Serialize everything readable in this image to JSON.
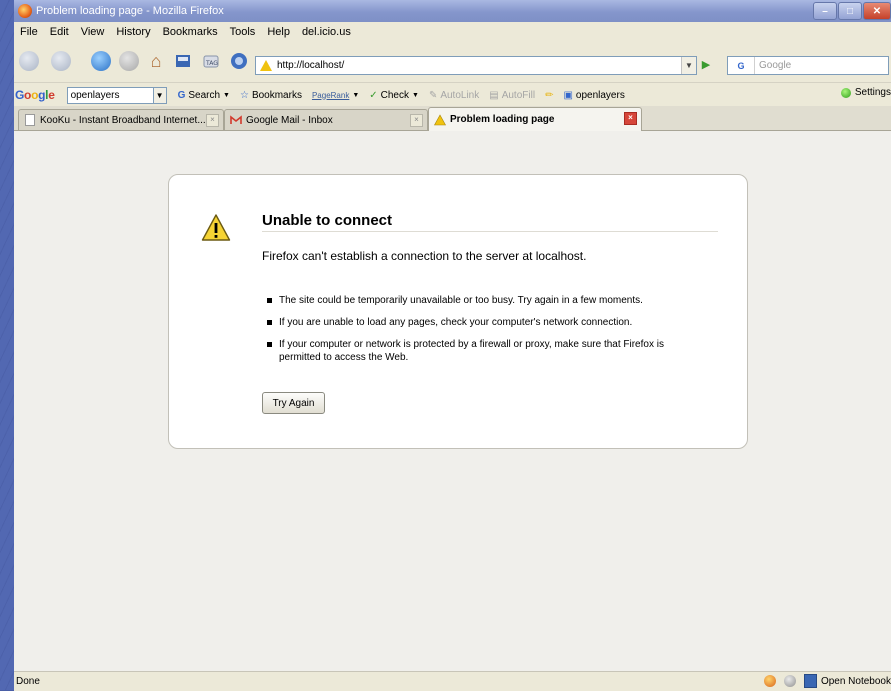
{
  "window": {
    "title": "Problem loading page - Mozilla Firefox",
    "controls": {
      "minimize": "–",
      "maximize": "□",
      "close": "✕"
    }
  },
  "menu": [
    "File",
    "Edit",
    "View",
    "History",
    "Bookmarks",
    "Tools",
    "Help",
    "del.icio.us"
  ],
  "navigation": {
    "url": "http://localhost/",
    "search_placeholder": "Google",
    "search_engine_icon": "G",
    "tag_label": "TAG"
  },
  "google_toolbar": {
    "search_value": "openlayers",
    "search_button": "Search",
    "bookmarks": "Bookmarks",
    "pagerank": "PageRank",
    "check": "Check",
    "autolink": "AutoLink",
    "autofill": "AutoFill",
    "highlight_term": "openlayers",
    "settings": "Settings"
  },
  "tabs": [
    {
      "label": "KooKu - Instant Broadband Internet...",
      "active": false
    },
    {
      "label": "Google Mail - Inbox",
      "active": false
    },
    {
      "label": "Problem loading page",
      "active": true
    }
  ],
  "error": {
    "title": "Unable to connect",
    "description": "Firefox can't establish a connection to the server at localhost.",
    "bullets": [
      "The site could be temporarily unavailable or too busy. Try again in a few moments.",
      "If you are unable to load any pages, check your computer's network connection.",
      "If your computer or network is protected by a firewall or proxy, make sure that Firefox is permitted to access the Web."
    ],
    "button": "Try Again"
  },
  "status": {
    "text": "Done",
    "open_notebook": "Open Notebook"
  },
  "colors": {
    "titlebar": "#8596cc",
    "chrome": "#ece9d8",
    "warning": "#f0c20f",
    "close_tab": "#d6463a"
  }
}
